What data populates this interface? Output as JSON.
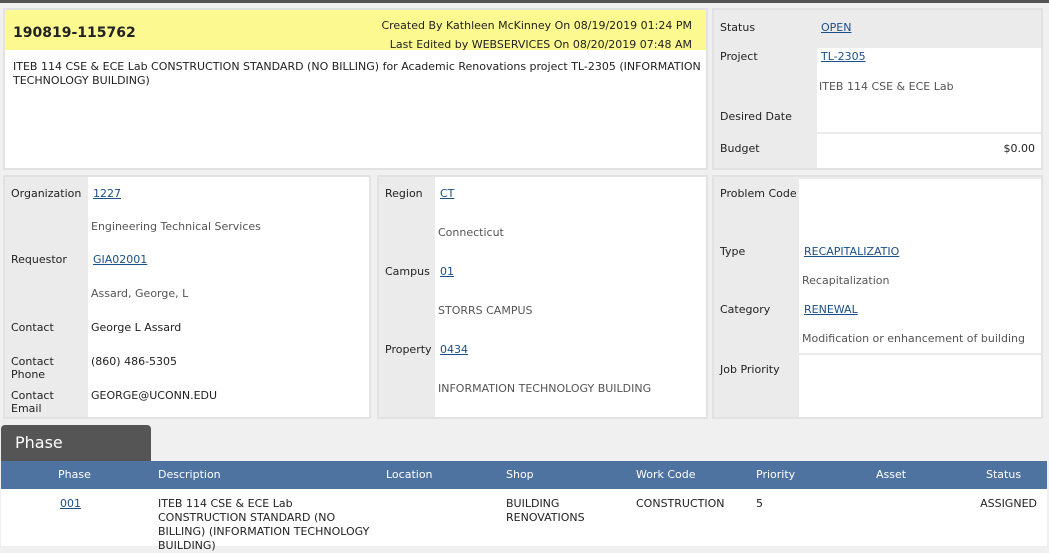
{
  "header": {
    "id": "190819-115762",
    "created": "Created By Kathleen McKinney On 08/19/2019 01:24 PM",
    "edited": "Last Edited by WEBSERVICES On 08/20/2019 07:48 AM",
    "description": "ITEB 114 CSE & ECE Lab CONSTRUCTION STANDARD (NO BILLING) for Academic Renovations project TL-2305 (INFORMATION TECHNOLOGY BUILDING)"
  },
  "summary": {
    "status_label": "Status",
    "status": "OPEN",
    "project_label": "Project",
    "project": "TL-2305",
    "project_desc": "ITEB 114 CSE & ECE Lab",
    "desired_label": "Desired Date",
    "budget_label": "Budget",
    "budget": "$0.00"
  },
  "requestor": {
    "org_label": "Organization",
    "org": "1227",
    "org_desc": "Engineering Technical Services",
    "req_label": "Requestor",
    "req": "GIA02001",
    "req_desc": "Assard, George, L",
    "contact_label": "Contact",
    "contact": "George L Assard",
    "phone_label": "Contact Phone",
    "phone": "(860) 486-5305",
    "email_label": "Contact Email",
    "email": "GEORGE@UCONN.EDU"
  },
  "location": {
    "region_label": "Region",
    "region": "CT",
    "region_desc": "Connecticut",
    "campus_label": "Campus",
    "campus": "01",
    "campus_desc": "STORRS CAMPUS",
    "property_label": "Property",
    "property": "0434",
    "property_desc": "INFORMATION TECHNOLOGY BUILDING"
  },
  "classification": {
    "problem_label": "Problem Code",
    "type_label": "Type",
    "type": "RECAPITALIZATIO",
    "type_desc": "Recapitalization",
    "category_label": "Category",
    "category": "RENEWAL",
    "category_desc": "Modification or enhancement of building",
    "priority_label": "Job Priority"
  },
  "phase": {
    "tab": "Phase",
    "columns": [
      "Phase",
      "Description",
      "Location",
      "Shop",
      "Work Code",
      "Priority",
      "Asset",
      "Status"
    ],
    "rows": [
      {
        "phase": "001",
        "description": "ITEB 114 CSE & ECE Lab CONSTRUCTION STANDARD (NO BILLING) (INFORMATION TECHNOLOGY BUILDING)",
        "location": "",
        "shop": "BUILDING RENOVATIONS",
        "work_code": "CONSTRUCTION",
        "priority": "5",
        "asset": "",
        "status": "ASSIGNED"
      }
    ]
  },
  "colors": {
    "header_bg": "#fbf98f",
    "table_header": "#4f73a0",
    "tab": "#555555",
    "link": "#1a4f8a"
  }
}
